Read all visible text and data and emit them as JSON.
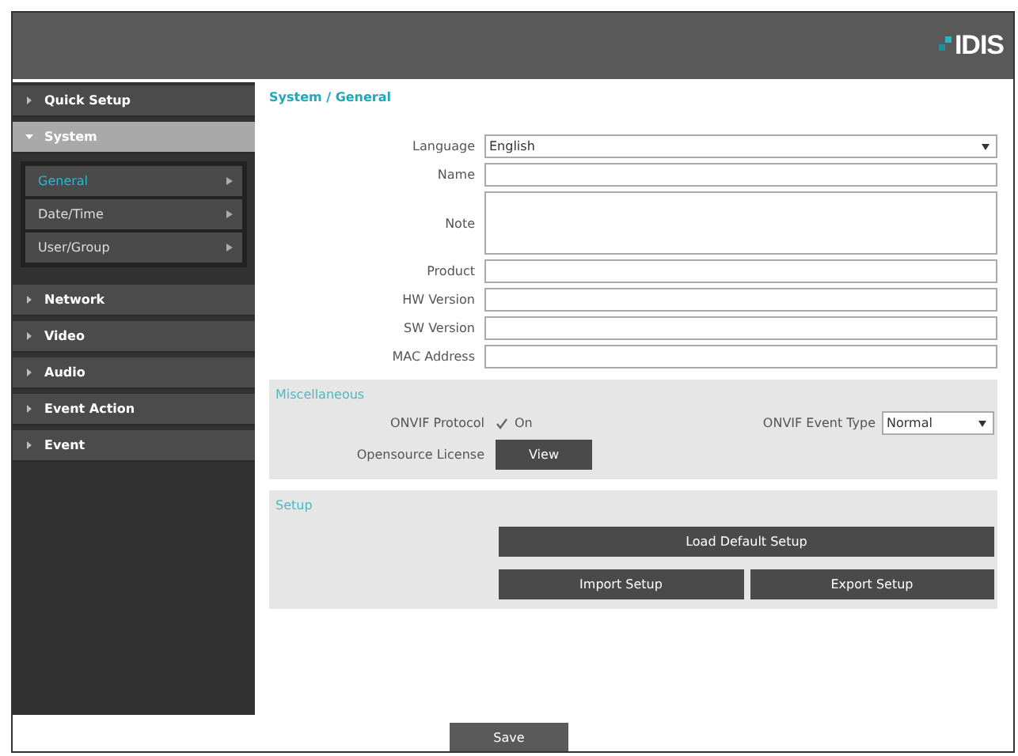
{
  "header": {
    "logo": "IDIS"
  },
  "sidebar": {
    "items": [
      {
        "label": "Quick Setup",
        "selected": false,
        "expanded": false
      },
      {
        "label": "System",
        "selected": true,
        "expanded": true,
        "children": [
          {
            "label": "General",
            "selected": true
          },
          {
            "label": "Date/Time",
            "selected": false
          },
          {
            "label": "User/Group",
            "selected": false
          }
        ]
      },
      {
        "label": "Network",
        "selected": false,
        "expanded": false
      },
      {
        "label": "Video",
        "selected": false,
        "expanded": false
      },
      {
        "label": "Audio",
        "selected": false,
        "expanded": false
      },
      {
        "label": "Event Action",
        "selected": false,
        "expanded": false
      },
      {
        "label": "Event",
        "selected": false,
        "expanded": false
      }
    ]
  },
  "breadcrumb": "System / General",
  "fields": [
    {
      "kind": "select",
      "label": "Language",
      "value": "English"
    },
    {
      "kind": "text",
      "label": "Name"
    },
    {
      "kind": "textarea",
      "label": "Note"
    },
    {
      "kind": "text",
      "label": "Product"
    },
    {
      "kind": "text",
      "label": "HW Version"
    },
    {
      "kind": "text",
      "label": "SW Version"
    },
    {
      "kind": "text",
      "label": "MAC Address"
    }
  ],
  "miscellaneous": {
    "title": "Miscellaneous",
    "onvif_protocol": {
      "label": "ONVIF Protocol",
      "checked": true,
      "option": "On"
    },
    "onvif_event_type": {
      "label": "ONVIF Event Type",
      "value": "Normal"
    },
    "opensource_license": {
      "label": "Opensource License",
      "button": "View"
    }
  },
  "setup": {
    "title": "Setup",
    "buttons": [
      "Load Default Setup",
      "Import Setup",
      "Export Setup"
    ]
  },
  "save_button": "Save"
}
